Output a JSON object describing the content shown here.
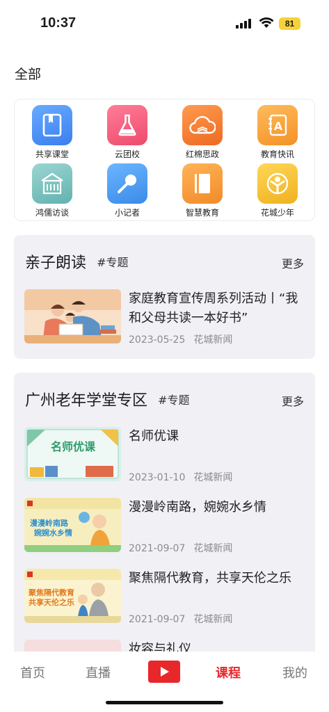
{
  "status_bar": {
    "time": "10:37",
    "battery": "81"
  },
  "section_title": "全部",
  "grid_items": [
    {
      "label": "共享课堂",
      "icon": "book-icon",
      "color": "#4a8ff7"
    },
    {
      "label": "云团校",
      "icon": "flask-icon",
      "color": "#f05a7a"
    },
    {
      "label": "红棉思政",
      "icon": "cloud-book-icon",
      "color": "#f47a2c"
    },
    {
      "label": "教育快讯",
      "icon": "news-icon",
      "color": "#f7a23a"
    },
    {
      "label": "鸿儒访谈",
      "icon": "building-icon",
      "color": "#7cc4c2"
    },
    {
      "label": "小记者",
      "icon": "microphone-icon",
      "color": "#4a9df0"
    },
    {
      "label": "智慧教育",
      "icon": "closed-book-icon",
      "color": "#f59b36"
    },
    {
      "label": "花城少年",
      "icon": "child-icon",
      "color": "#f4c432"
    }
  ],
  "card1": {
    "title": "亲子朗读",
    "tag": "#专题",
    "more": "更多",
    "items": [
      {
        "title": "家庭教育宣传周系列活动丨“我和父母共读一本好书”",
        "date": "2023-05-25",
        "source": "花城新闻"
      }
    ]
  },
  "card2": {
    "title": "广州老年学堂专区",
    "tag": "#专题",
    "more": "更多",
    "items": [
      {
        "title": "名师优课",
        "date": "2023-01-10",
        "source": "花城新闻",
        "thumb_text": "名师优课"
      },
      {
        "title": "漫漫岭南路，婉婉水乡情",
        "date": "2021-09-07",
        "source": "花城新闻",
        "thumb_text_1": "漫漫岭南路",
        "thumb_text_2": "婉婉水乡情"
      },
      {
        "title": "聚焦隔代教育，共享天伦之乐",
        "date": "2021-09-07",
        "source": "花城新闻",
        "thumb_text_1": "聚焦隔代教育",
        "thumb_text_2": "共享天伦之乐"
      },
      {
        "title": "妆容与礼仪"
      }
    ]
  },
  "tabbar": {
    "home": "首页",
    "live": "直播",
    "course": "课程",
    "mine": "我的"
  },
  "colors": {
    "accent": "#e8272b",
    "card_bg": "#f0f0f5"
  }
}
